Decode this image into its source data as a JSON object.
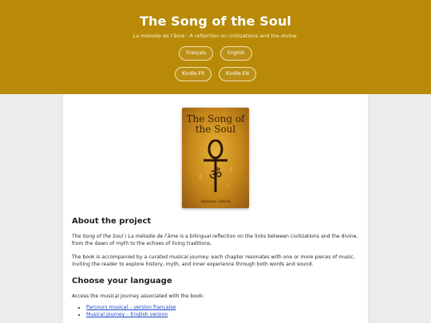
{
  "header": {
    "title": "The Song of the Soul",
    "subtitle": "La mélodie de l'âme · A reflection on civilizations and the divine.",
    "buttons_row1": [
      "Français",
      "English"
    ],
    "buttons_row2": [
      "Kindle FR",
      "Kindle EN"
    ]
  },
  "cover": {
    "title": "The Song of the Soul",
    "author": "Antoine Satori"
  },
  "about": {
    "heading": "About the project",
    "p1_title_en": "The Song of the Soul",
    "p1_sep": " / ",
    "p1_title_fr": "La mélodie de l'âme",
    "p1_rest": " is a bilingual reflection on the links between civilizations and the divine, from the dawn of myth to the echoes of living traditions.",
    "p2": "The book is accompanied by a curated musical journey: each chapter resonates with one or more pieces of music, inviting the reader to explore history, myth, and inner experience through both words and sound."
  },
  "language": {
    "heading": "Choose your language",
    "intro": "Access the musical journey associated with the book:",
    "links": [
      "Parcours musical – version française",
      "Musical journey – English version"
    ]
  },
  "colors": {
    "header_bg": "#b88a08",
    "link": "#1a44c8"
  }
}
